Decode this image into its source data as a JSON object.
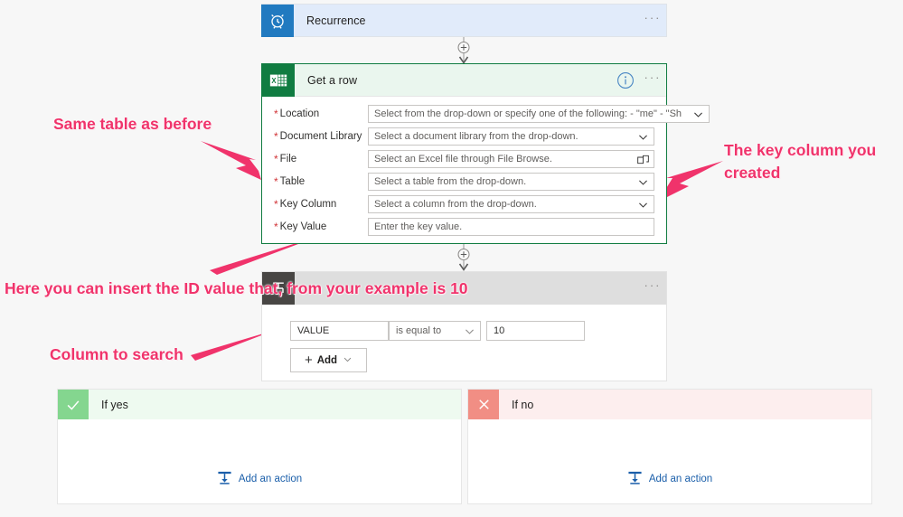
{
  "accent_colors": {
    "recurrence_blue": "#217ac0",
    "recurrence_card_bg": "#e1ebfa",
    "excel_green": "#107c41",
    "getarow_header_bg": "#eaf6ee",
    "condition_icon_gray": "#484644",
    "condition_header_bg": "#dedede",
    "yes_green": "#84d68f",
    "no_red": "#f18e84",
    "annotation_pink": "#f0336b",
    "link_blue": "#1b5faa",
    "required_red": "#d13438",
    "canvas_bg": "#f7f7f7"
  },
  "recurrence": {
    "title": "Recurrence",
    "icon": "alarm-clock-icon",
    "overflow_label": "···"
  },
  "get_a_row": {
    "title": "Get a row",
    "icon": "excel-file-icon",
    "info_label": "i",
    "overflow_label": "···",
    "fields": [
      {
        "required": "*",
        "label": "Location",
        "value": "Select from the drop-down or specify one of the following: - \"me\" - \"Sh",
        "control": "dropdown"
      },
      {
        "required": "*",
        "label": "Document Library",
        "value": "Select a document library from the drop-down.",
        "control": "dropdown"
      },
      {
        "required": "*",
        "label": "File",
        "value": "Select an Excel file through File Browse.",
        "control": "filebrowse"
      },
      {
        "required": "*",
        "label": "Table",
        "value": "Select a table from the drop-down.",
        "control": "dropdown"
      },
      {
        "required": "*",
        "label": "Key Column",
        "value": "Select a column from the drop-down.",
        "control": "dropdown"
      },
      {
        "required": "*",
        "label": "Key Value",
        "value": "Enter the key value.",
        "control": "text"
      }
    ]
  },
  "condition": {
    "title": "",
    "icon": "condition-icon",
    "overflow_label": "···",
    "left_operand": "VALUE",
    "operator": "is equal to",
    "right_operand": "10",
    "add_label": "Add"
  },
  "branches": [
    {
      "title": "If yes",
      "icon": "checkmark-icon",
      "add_action_label": "Add an action",
      "add_action_icon": "add-action-icon"
    },
    {
      "title": "If no",
      "icon": "cross-icon",
      "add_action_label": "Add an action",
      "add_action_icon": "add-action-icon"
    }
  ],
  "connectors": [
    {
      "icon": "plus-circle-icon"
    },
    {
      "icon": "plus-circle-icon"
    }
  ],
  "annotations": [
    {
      "text": "Same table as before",
      "arrow": "points down-right toward the Table field"
    },
    {
      "text": "The key column you\ncreated",
      "arrow": "points down-left toward the Key Column field"
    },
    {
      "text": "Here you can insert the ID value that, from your example is 10",
      "arrow": "points up-right toward the Key Value field"
    },
    {
      "text": "Column to search",
      "arrow": "points up-right toward the VALUE condition input"
    }
  ]
}
